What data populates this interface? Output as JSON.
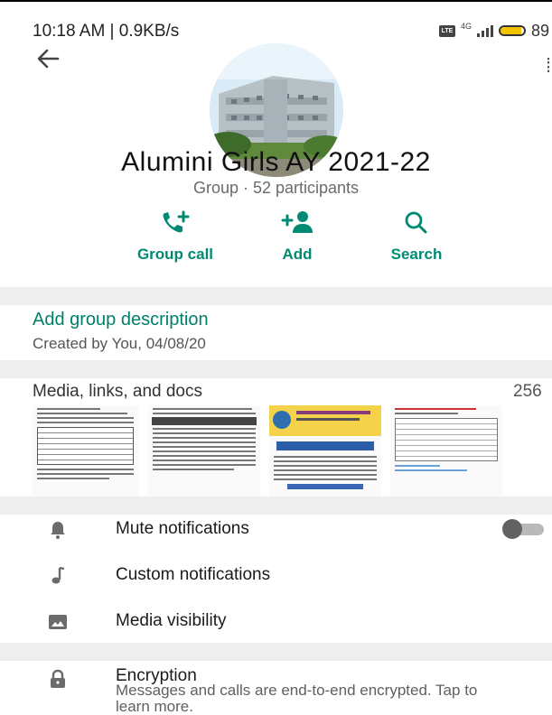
{
  "status_bar": {
    "time": "10:18 AM | 0.9KB/s",
    "network_badge": "LTE",
    "network_type": "4G",
    "battery_label": "89",
    "battery_level": 0.89,
    "battery_color": "#f2c400"
  },
  "header": {
    "back_icon": "arrow-left-icon",
    "group_name": "Alumini Girls AY 2021-22",
    "group_subtitle": "Group · 52 participants"
  },
  "actions": [
    {
      "label": "Group call",
      "icon": "phone-add-icon"
    },
    {
      "label": "Add",
      "icon": "person-add-icon"
    },
    {
      "label": "Search",
      "icon": "search-icon"
    }
  ],
  "description": {
    "link_label": "Add group description",
    "created_text": "Created by You, 04/08/20"
  },
  "media": {
    "title": "Media, links, and docs",
    "count": "256"
  },
  "settings": [
    {
      "label": "Mute notifications",
      "icon": "bell-icon",
      "toggle_on": false
    },
    {
      "label": "Custom notifications",
      "icon": "music-note-icon"
    },
    {
      "label": "Media visibility",
      "icon": "image-icon"
    }
  ],
  "encryption": {
    "title": "Encryption",
    "description": "Messages and calls are end-to-end encrypted. Tap to learn more.",
    "icon": "lock-icon"
  },
  "colors": {
    "accent": "#008069",
    "divider": "#eeeeee",
    "icon_gray": "#6b6b6b"
  }
}
